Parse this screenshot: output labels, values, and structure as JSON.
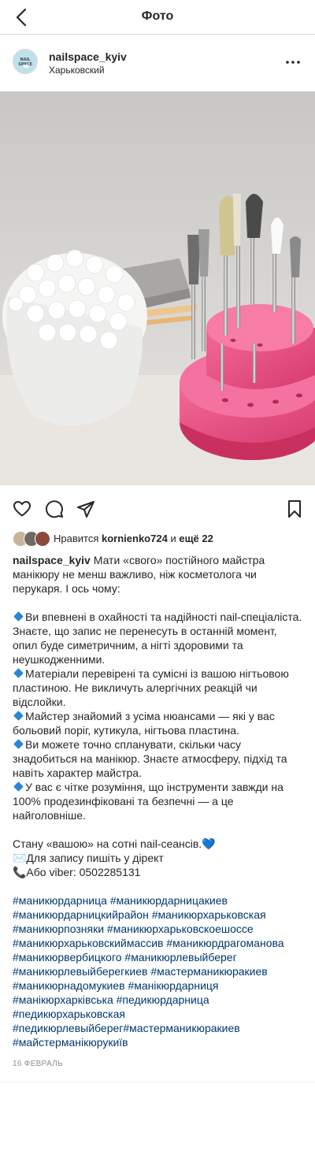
{
  "header": {
    "title": "Фото"
  },
  "post": {
    "username": "nailspace_kyiv",
    "location": "Харьковский",
    "avatar_text": "NAIL SPACE",
    "likes": {
      "prefix": "Нравится",
      "user": "kornienko724",
      "middle": "и",
      "rest": "ещё 22"
    },
    "caption": {
      "intro": "Мати «свого» постійного майстра манікюру не менш важливо, ніж косметолога чи перукаря. І ось чому:",
      "points": [
        "Ви впевнені в охайності та надійності nail-спеціаліста. Знаєте, що запис не перенесуть в останній момент, опил буде симетричним, а нігті здоровими та неушкодженними.",
        "Матеріали перевірені та сумісні із вашою нігтьовою пластиною. Не викличуть алергічних реакцій чи відслойки.",
        "Майстер знайомий з усіма нюансами — які у вас больовий поріг, кутикула, нігтьова пластина.",
        "Ви можете точно спланувати, скільки часу знадобиться на манікюр. Знаєте атмосферу, підхід та навіть характер майстра.",
        "У вас є чітке розуміння, що інструменти завжди на 100% продезинфіковані та безпечні — а це найголовніше."
      ],
      "outro": "Стану «вашою» на сотні nail-сеансів.",
      "outro_emoji": "💙",
      "contact_line1": "✉️Для запису пишіть у дірект",
      "contact_line2": "📞Або viber: 0502285131"
    },
    "hashtags": [
      "#маникюрдарница #маникюрдарницакиев",
      "#маникюрдарницкийрайон #маникюрхарьковская",
      "#маникюрпозняки #маникюрхарьковскоешоссе",
      "#маникюрхарьковскиймассив #маникюрдрагоманова",
      "#маникюрвербицкого #маникюрлевыйберег",
      "#маникюрлевыйберегкиев #мастерманикюракиев",
      "#маникюрнадомукиев #манікюрдарниця",
      "#манікюрхарківська #педикюрдарница",
      "#педикюрхарьковская",
      "#педикюрлевыйберег#мастерманикюракиев",
      "#майстерманікюрукиїв"
    ],
    "date": "16 ФЕВРАЛЬ"
  },
  "colors": {
    "accent_blue": "#2a85d8",
    "hashtag": "#00376b",
    "muted": "#8e8e8e",
    "pink_stand": "#e8457b"
  }
}
